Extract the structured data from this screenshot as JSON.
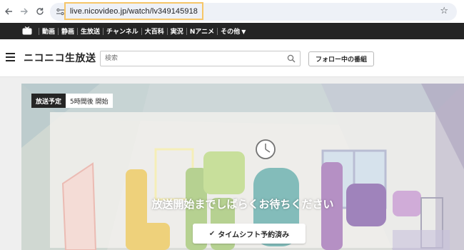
{
  "browser": {
    "back_icon": "back-arrow-icon",
    "forward_icon": "forward-arrow-icon",
    "reload_icon": "reload-icon",
    "url": "live.nicovideo.jp/watch/lv349145918",
    "bookmark_icon": "star-icon",
    "highlight_color": "#f6c668"
  },
  "nico_nav": {
    "items": [
      "動画",
      "静画",
      "生放送",
      "チャンネル",
      "大百科",
      "実況",
      "Nアニメ",
      "その他"
    ],
    "more_chevron": "chevron-down-icon"
  },
  "header": {
    "logo_text": "ニコニコ生放送",
    "search_placeholder": "検索",
    "follow_label": "フォロー中の番組"
  },
  "player": {
    "status_label": "放送予定",
    "status_detail": "5時間後 開始",
    "wait_message": "放送開始までしばらくお待ちください",
    "reserve_label": "タイムシフト予約済み"
  }
}
